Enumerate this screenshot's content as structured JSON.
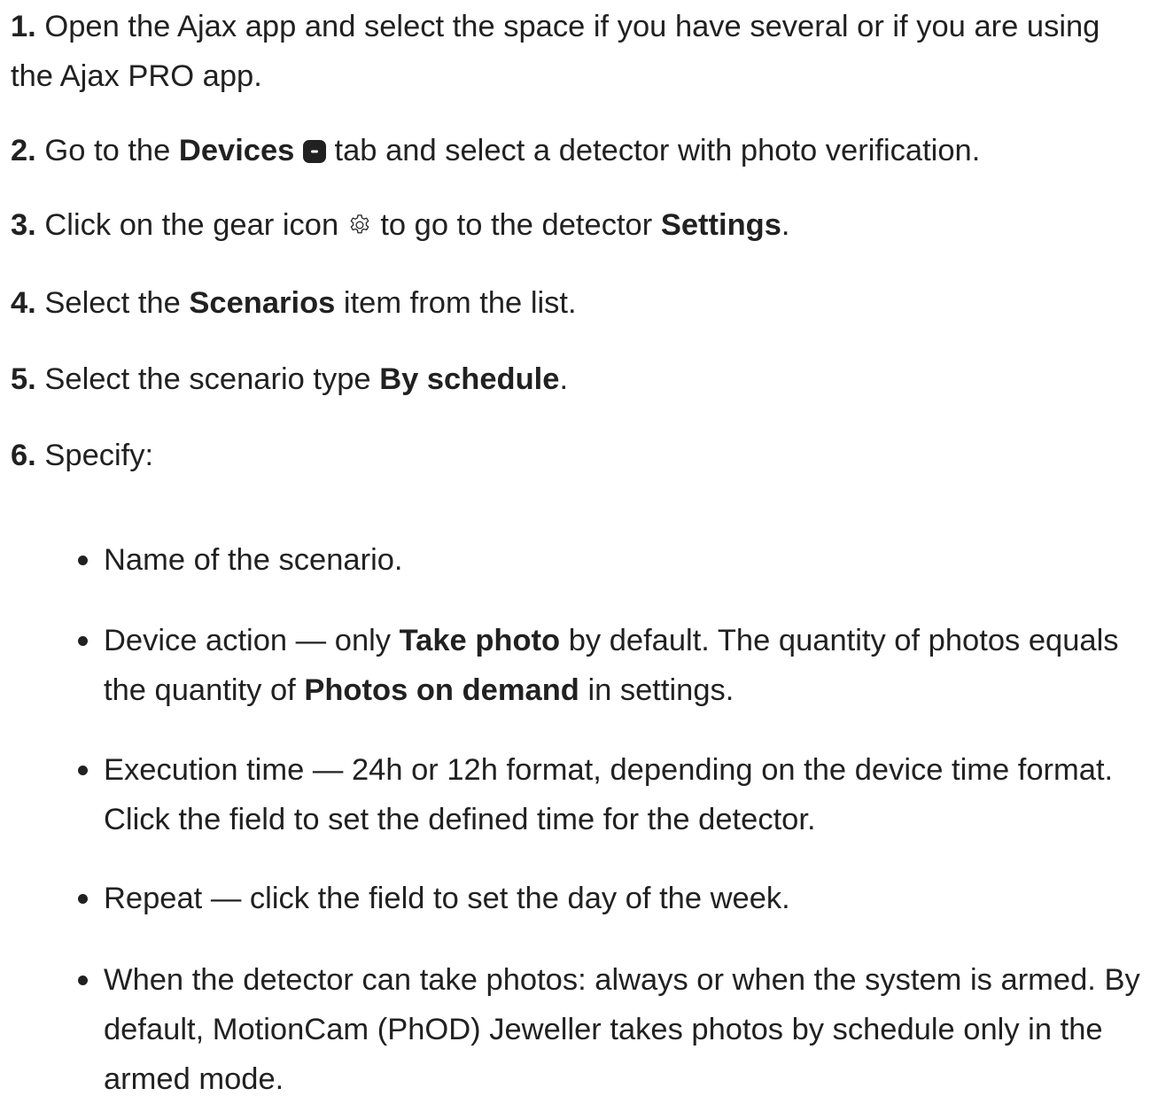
{
  "steps": [
    {
      "num": "1.",
      "text": "Open the Ajax app and select the space if you have several or if you are using the Ajax PRO app."
    },
    {
      "num": "2.",
      "pre": "Go to the",
      "bold": "Devices",
      "icon": "devices-tab-icon",
      "post": "tab and select a detector with photo verification."
    },
    {
      "num": "3.",
      "pre": "Click on the gear icon",
      "icon": "gear-icon",
      "mid": "to go to the detector",
      "bold": "Settings",
      "post": "."
    },
    {
      "num": "4.",
      "pre": "Select the",
      "bold": "Scenarios",
      "post": "item from the list."
    },
    {
      "num": "5.",
      "pre": "Select the scenario type",
      "bold": "By schedule",
      "post": "."
    },
    {
      "num": "6.",
      "text": "Specify:"
    }
  ],
  "bullets": [
    {
      "text": "Name of the scenario."
    },
    {
      "pre": "Device action — only",
      "bold1": "Take photo",
      "mid": "by default. The quantity of photos equals the quantity of",
      "bold2": "Photos on demand",
      "post": "in settings."
    },
    {
      "text": "Execution time — 24h or 12h format, depending on the device time format. Click the field to set the defined time for the detector."
    },
    {
      "text": "Repeat — click the field to set the day of the week."
    },
    {
      "text": "When the detector can take photos: always or when the system is armed. By default, MotionCam (PhOD) Jeweller takes photos by schedule only in the armed mode."
    }
  ]
}
